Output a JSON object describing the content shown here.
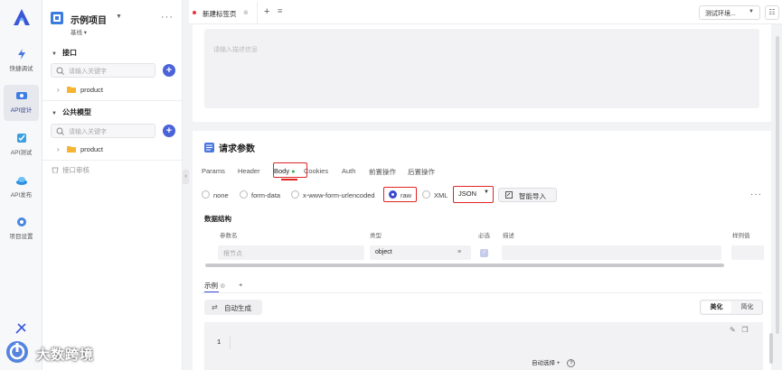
{
  "rail": {
    "items": [
      {
        "label": "快捷调试",
        "icon": "lightning-icon"
      },
      {
        "label": "API设计",
        "icon": "api-design-icon"
      },
      {
        "label": "API测试",
        "icon": "api-test-icon"
      },
      {
        "label": "API发布",
        "icon": "api-publish-icon"
      },
      {
        "label": "项目设置",
        "icon": "project-settings-icon"
      }
    ],
    "active_index": 1
  },
  "tree": {
    "project_name": "示例项目",
    "project_branch": "基线",
    "sections": [
      {
        "title": "接口",
        "search_placeholder": "请输入关键字",
        "folder": "product"
      },
      {
        "title": "公共模型",
        "search_placeholder": "请输入关键字",
        "folder": "product"
      }
    ],
    "recycle_label": "接口审核"
  },
  "tabs": {
    "items": [
      {
        "label": "新建标签页"
      }
    ],
    "env_select": "测试环境..."
  },
  "description": {
    "placeholder": "请输入描述信息"
  },
  "request": {
    "title": "请求参数",
    "subtabs": [
      "Params",
      "Header",
      "Body",
      "Cookies",
      "Auth",
      "前置操作",
      "后置操作"
    ],
    "active_subtab": "Body",
    "body_types": [
      "none",
      "form-data",
      "x-www-form-urlencoded",
      "raw",
      "XML"
    ],
    "selected_body_type": "raw",
    "raw_format": "JSON",
    "import_label": "智能导入",
    "structure_title": "数据结构",
    "columns": {
      "name": "参数名",
      "type": "类型",
      "required": "必选",
      "desc": "描述",
      "example": "样例值"
    },
    "root_row": {
      "name_placeholder": "根节点",
      "type": "object"
    },
    "example_tab": "示例",
    "autogen_label": "自动生成",
    "format_buttons": [
      "美化",
      "简化"
    ],
    "active_format": "美化",
    "editor_line": "1"
  },
  "footer": {
    "auto_select": "自动选择",
    "help": "?"
  },
  "watermark": {
    "text": "大数跨境"
  },
  "colors": {
    "accent": "#3a4bd0",
    "highlight": "#e02424",
    "status_green": "#2fae4a"
  }
}
